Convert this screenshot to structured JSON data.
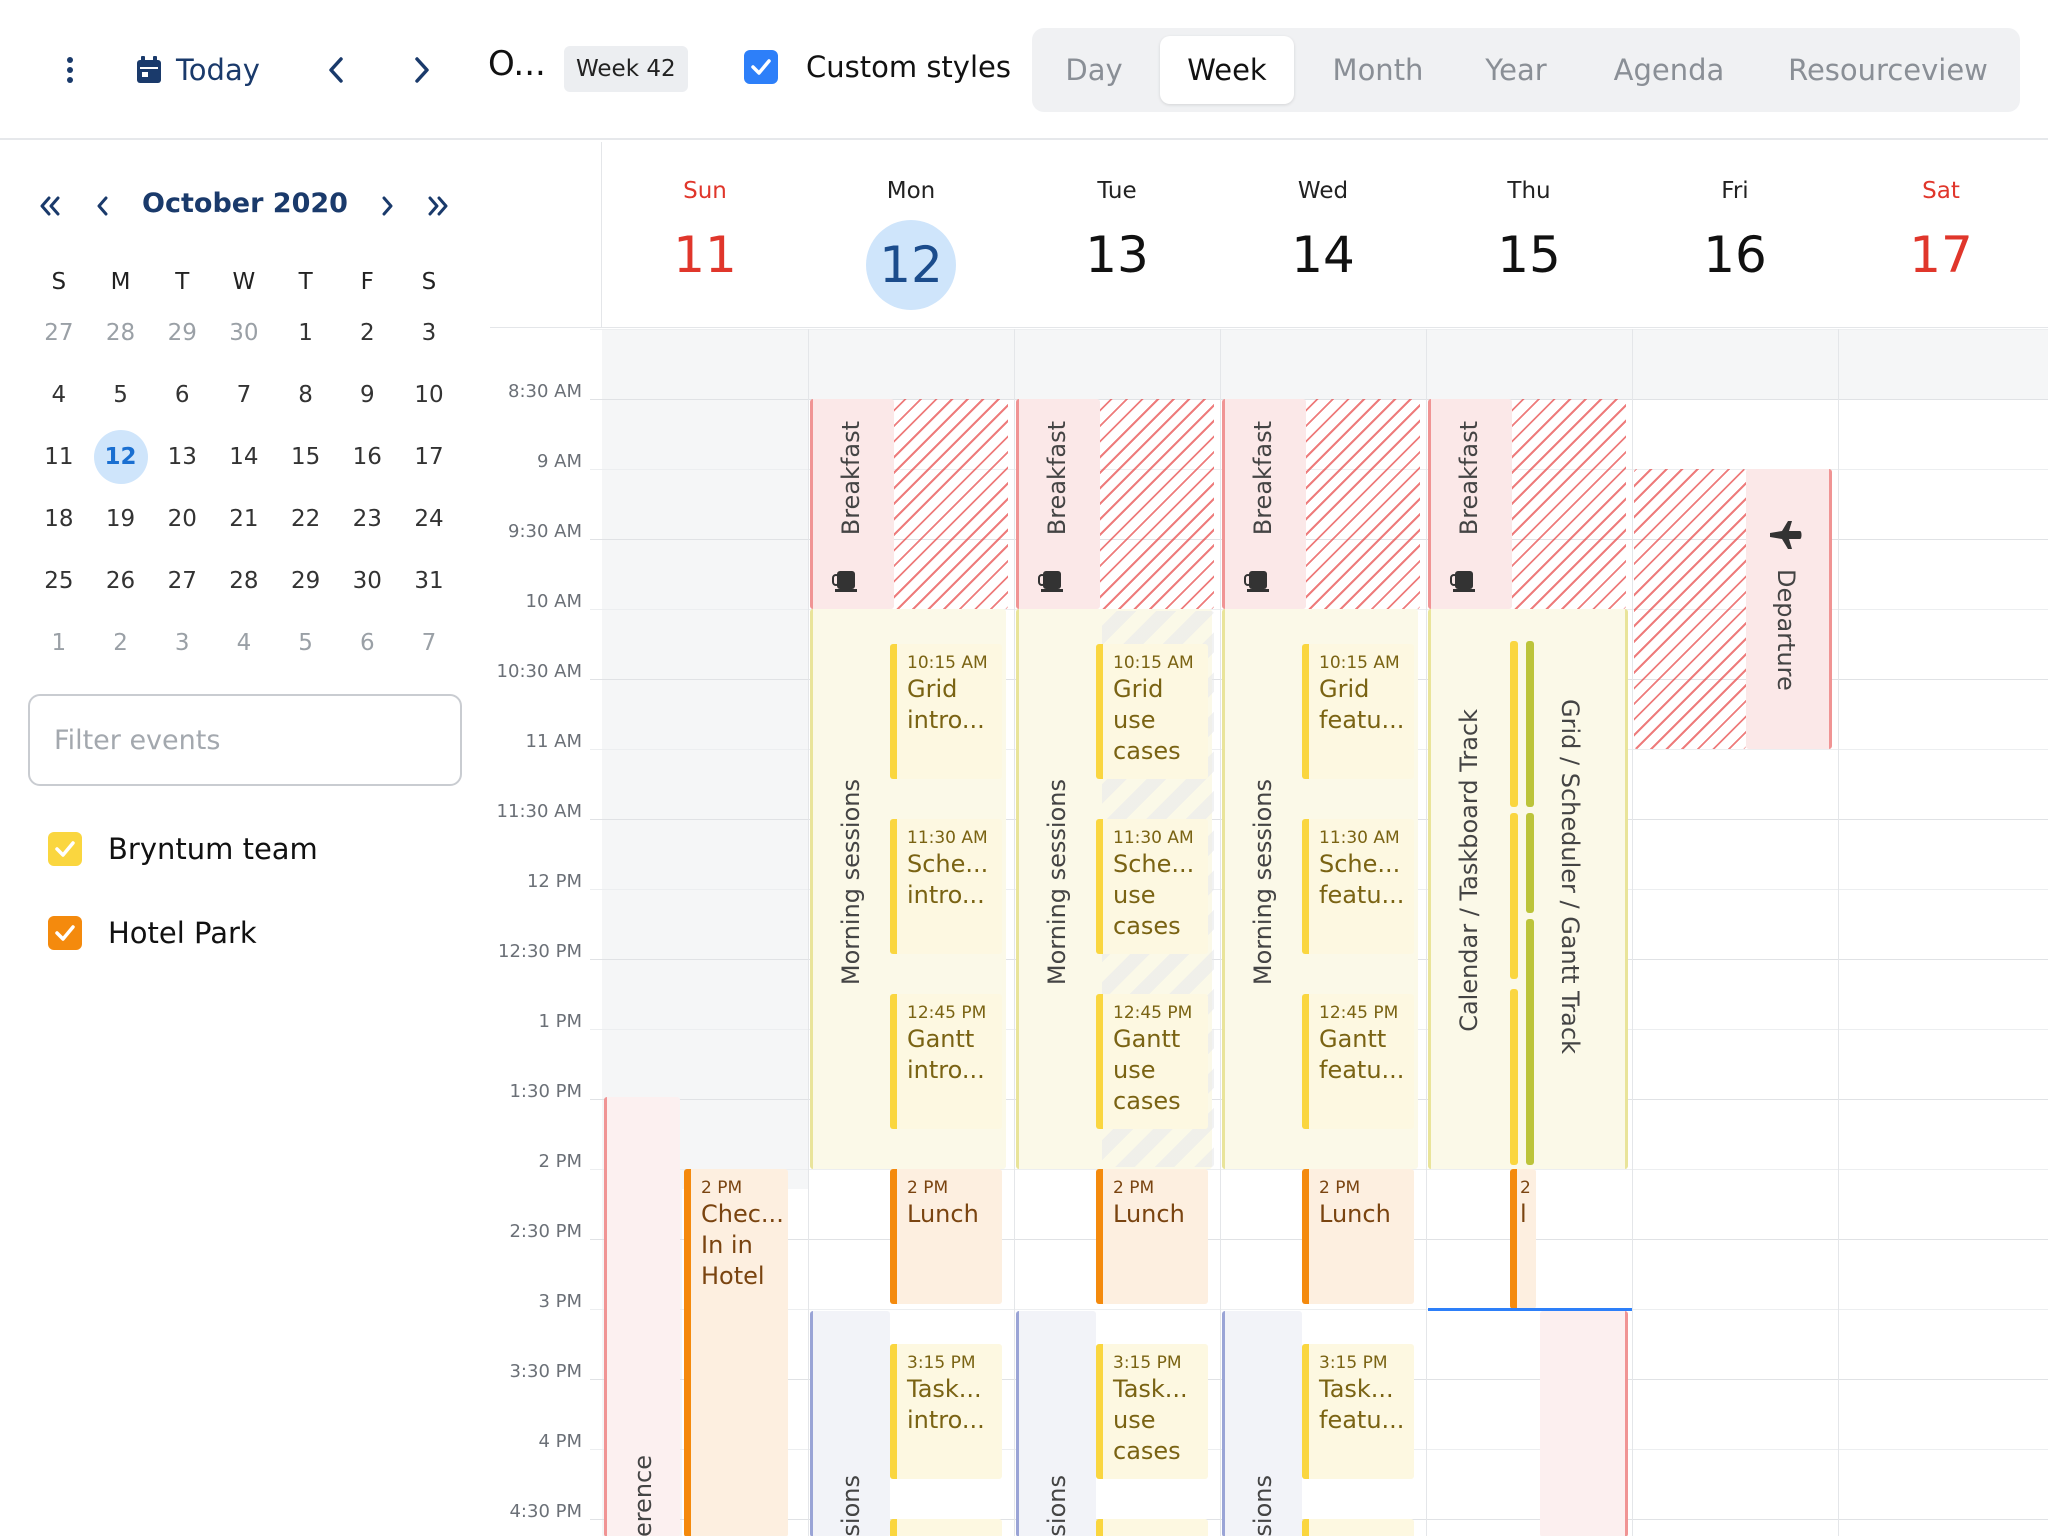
{
  "toolbar": {
    "today_label": "Today",
    "view_title": "O...",
    "week_badge": "Week 42",
    "custom_styles_label": "Custom styles",
    "views": [
      "Day",
      "Week",
      "Month",
      "Year",
      "Agenda",
      "Resourceview"
    ],
    "active_view": "Week"
  },
  "sidebar": {
    "month_title": "October 2020",
    "weekdays": [
      "S",
      "M",
      "T",
      "W",
      "T",
      "F",
      "S"
    ],
    "weeks": [
      [
        "27",
        "28",
        "29",
        "30",
        "1",
        "2",
        "3"
      ],
      [
        "4",
        "5",
        "6",
        "7",
        "8",
        "9",
        "10"
      ],
      [
        "11",
        "12",
        "13",
        "14",
        "15",
        "16",
        "17"
      ],
      [
        "18",
        "19",
        "20",
        "21",
        "22",
        "23",
        "24"
      ],
      [
        "25",
        "26",
        "27",
        "28",
        "29",
        "30",
        "31"
      ],
      [
        "1",
        "2",
        "3",
        "4",
        "5",
        "6",
        "7"
      ]
    ],
    "today_date": "12",
    "filter_placeholder": "Filter events",
    "resources": [
      {
        "label": "Bryntum team",
        "color": "#fad63f"
      },
      {
        "label": "Hotel Park",
        "color": "#f48a0d"
      }
    ]
  },
  "week": {
    "days": [
      {
        "name": "Sun",
        "date": "11",
        "weekend": true
      },
      {
        "name": "Mon",
        "date": "12",
        "today": true
      },
      {
        "name": "Tue",
        "date": "13"
      },
      {
        "name": "Wed",
        "date": "14"
      },
      {
        "name": "Thu",
        "date": "15"
      },
      {
        "name": "Fri",
        "date": "16"
      },
      {
        "name": "Sat",
        "date": "17",
        "weekend": true
      }
    ],
    "time_labels": [
      "8:30 AM",
      "9 AM",
      "9:30 AM",
      "10 AM",
      "10:30 AM",
      "11 AM",
      "11:30 AM",
      "12 PM",
      "12:30 PM",
      "1 PM",
      "1:30 PM",
      "2 PM",
      "2:30 PM",
      "3 PM",
      "3:30 PM",
      "4 PM",
      "4:30 PM"
    ]
  },
  "events": {
    "breakfast": "Breakfast",
    "morning_sessions": "Morning sessions",
    "sessions_cut": "sions",
    "conference_cut": "erence",
    "departure": "Departure",
    "calendar_track": "Calendar / Taskboard Track",
    "grid_track": "Grid / Scheduler / Gantt Track",
    "checkin_time": "2 PM",
    "checkin_name": "Chec... In in Hotel",
    "lunch_time": "2 PM",
    "lunch_name": "Lunch",
    "thu_lunch_time": "2",
    "thu_lunch_name": "l",
    "mon": [
      {
        "time": "10:15 AM",
        "name": "Grid intro..."
      },
      {
        "time": "11:30 AM",
        "name": "Sche... intro..."
      },
      {
        "time": "12:45 PM",
        "name": "Gantt intro..."
      },
      {
        "time": "3:15 PM",
        "name": "Task... intro..."
      }
    ],
    "tue": [
      {
        "time": "10:15 AM",
        "name": "Grid use cases"
      },
      {
        "time": "11:30 AM",
        "name": "Sche... use cases"
      },
      {
        "time": "12:45 PM",
        "name": "Gantt use cases"
      },
      {
        "time": "3:15 PM",
        "name": "Task... use cases"
      }
    ],
    "wed": [
      {
        "time": "10:15 AM",
        "name": "Grid featu..."
      },
      {
        "time": "11:30 AM",
        "name": "Sche... featu..."
      },
      {
        "time": "12:45 PM",
        "name": "Gantt featu..."
      },
      {
        "time": "3:15 PM",
        "name": "Task... featu..."
      }
    ]
  },
  "colors": {
    "accent": "#2d7ff9",
    "brand": "#1a3a6b",
    "weekend": "#e0362b",
    "yellow": "#fad63f",
    "orange": "#f48a0d"
  }
}
